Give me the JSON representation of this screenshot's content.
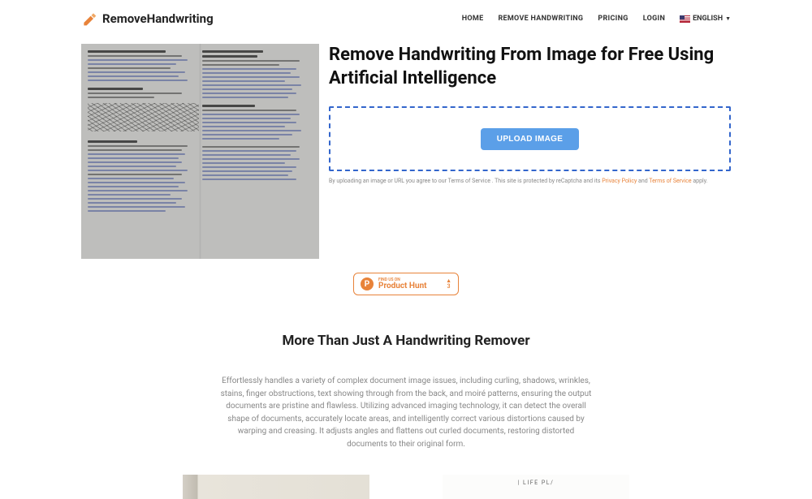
{
  "brand": {
    "name": "RemoveHandwriting"
  },
  "nav": {
    "home": "HOME",
    "remove": "REMOVE HANDWRITING",
    "pricing": "PRICING",
    "login": "LOGIN",
    "language": "ENGLISH"
  },
  "hero": {
    "title": "Remove Handwriting From Image for Free Using Artificial Intelligence",
    "upload_button": "UPLOAD IMAGE",
    "terms_prefix": "By uploading an image or URL you agree to our Terms of Service . This site is protected by reCaptcha and its ",
    "privacy_link": "Privacy Policy",
    "terms_mid": " and ",
    "tos_link": "Terms of Service",
    "terms_suffix": " apply."
  },
  "product_hunt": {
    "letter": "P",
    "find_text": "FIND US ON",
    "name": "Product Hunt",
    "upvote_count": "3"
  },
  "section": {
    "title": "More Than Just A Handwriting Remover",
    "description": "Effortlessly handles a variety of complex document image issues, including curling, shadows, wrinkles, stains, finger obstructions, text showing through from the back, and moiré patterns, ensuring the output documents are pristine and flawless. Utilizing advanced imaging technology, it can detect the overall shape of documents, accurately locate areas, and intelligently correct various distortions caused by warping and creasing. It adjusts angles and flattens out curled documents, restoring distorted documents to their original form."
  },
  "gallery": {
    "right_caption": "| LIFE PL/"
  }
}
